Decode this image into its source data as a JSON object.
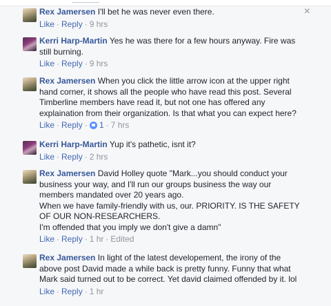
{
  "ui": {
    "like_label": "Like",
    "reply_label": "Reply",
    "separator": "·",
    "close_glyph": "×"
  },
  "comments": [
    {
      "author": "Rex Jamersen",
      "text": "I'll bet he was never even there.",
      "time": "9 hrs"
    },
    {
      "author": "Kerri Harp-Martin",
      "text": "Yes he was there for a few hours anyway. Fire was still burning.",
      "time": "9 hrs"
    },
    {
      "author": "Rex Jamersen",
      "text": "When you click the little arrow icon at the upper right hand corner, it shows all the people who have read this post. Several Timberline members have read it, but not one has offered any explaination from their organization. Is that what you can expect here?",
      "time": "7 hrs",
      "likes": "1"
    },
    {
      "author": "Kerri Harp-Martin",
      "text": "Yup it's pathetic, isnt it?",
      "time": "2 hrs"
    },
    {
      "author": "Rex Jamersen",
      "text": "David Holley quote \"Mark...you should conduct your business your way, and I'll run our groups business the way our members mandated over 20 years ago.",
      "text2": "When we have family-friendly with us, our. PRIORITY. IS THE SAFETY OF OUR NON-RESEARCHERS.",
      "text3": "I'm offended that you imply we don't give a damn\"",
      "time": "1 hr",
      "edited": "Edited"
    },
    {
      "author": "Rex Jamersen",
      "text": "In light of the latest developement, the irony of the above post David made a while back is pretty funny. Funny that what Mark said turned out to be correct. Yet david claimed offended by it. lol",
      "time": "1 hr"
    }
  ]
}
